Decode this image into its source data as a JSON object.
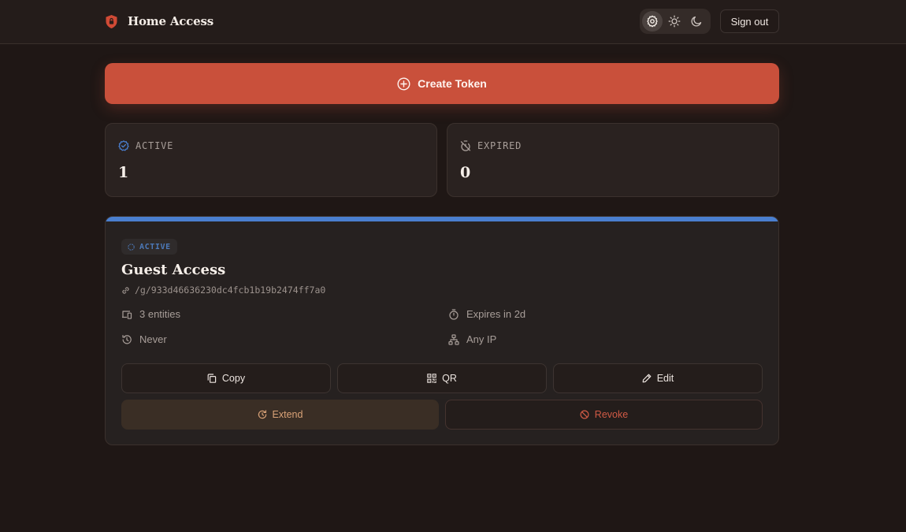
{
  "header": {
    "app_name": "Home Access",
    "logo_icon": "shield-icon",
    "theme_options": [
      {
        "name": "system",
        "icon": "gear-icon",
        "active": true
      },
      {
        "name": "light",
        "icon": "sun-icon",
        "active": false
      },
      {
        "name": "dark",
        "icon": "moon-icon",
        "active": false
      }
    ],
    "signout_label": "Sign out"
  },
  "create_button": {
    "label": "Create Token",
    "icon": "plus-circle-icon"
  },
  "stats": {
    "active": {
      "label": "ACTIVE",
      "value": "1",
      "icon": "check-badge-icon"
    },
    "expired": {
      "label": "EXPIRED",
      "value": "0",
      "icon": "timer-off-icon"
    }
  },
  "token": {
    "status": "ACTIVE",
    "name": "Guest Access",
    "url": "/g/933d46636230dc4fcb1b19b2474ff7a0",
    "entities": "3 entities",
    "expires": "Expires in 2d",
    "last_used": "Never",
    "ip": "Any IP",
    "actions": {
      "copy": "Copy",
      "qr": "QR",
      "edit": "Edit",
      "extend": "Extend",
      "revoke": "Revoke"
    }
  },
  "colors": {
    "accent": "#c9503b",
    "active_blue": "#4a7fcf",
    "background": "#1f1715",
    "extend": "#d9a277",
    "revoke": "#d05a45"
  }
}
